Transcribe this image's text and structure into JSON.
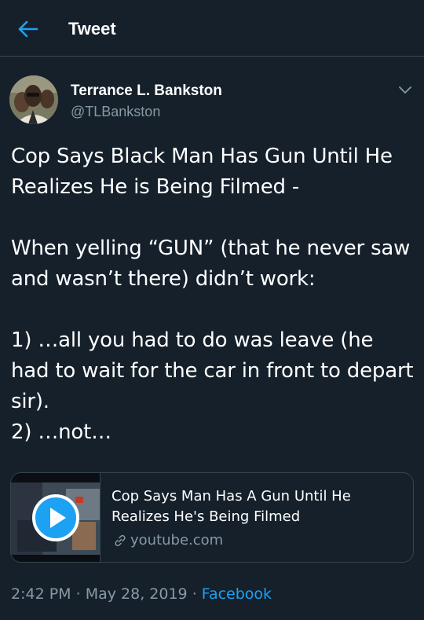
{
  "header": {
    "title": "Tweet",
    "back_icon": "arrow-left-icon"
  },
  "colors": {
    "background": "#15202b",
    "accent": "#1da1f2",
    "secondary_text": "#8899a6",
    "border": "#38444d"
  },
  "tweet": {
    "author": {
      "name": "Terrance L. Bankston",
      "handle": "@TLBankston"
    },
    "paragraphs": [
      "Cop Says Black Man Has Gun Until He Realizes He is Being Filmed -",
      "When yelling “GUN” (that he never saw and wasn’t there) didn’t work:",
      "1)  …all you had to do was leave (he had to wait for the car in front to depart sir).\n2)  …not…"
    ],
    "card": {
      "title": "Cop Says Man Has A Gun Until He Realizes He's Being Filmed",
      "domain": "youtube.com",
      "play_icon": "play-icon",
      "link_icon": "link-icon"
    },
    "meta": {
      "time": "2:42 PM",
      "separator": "·",
      "date": "May 28, 2019",
      "source": "Facebook"
    }
  }
}
